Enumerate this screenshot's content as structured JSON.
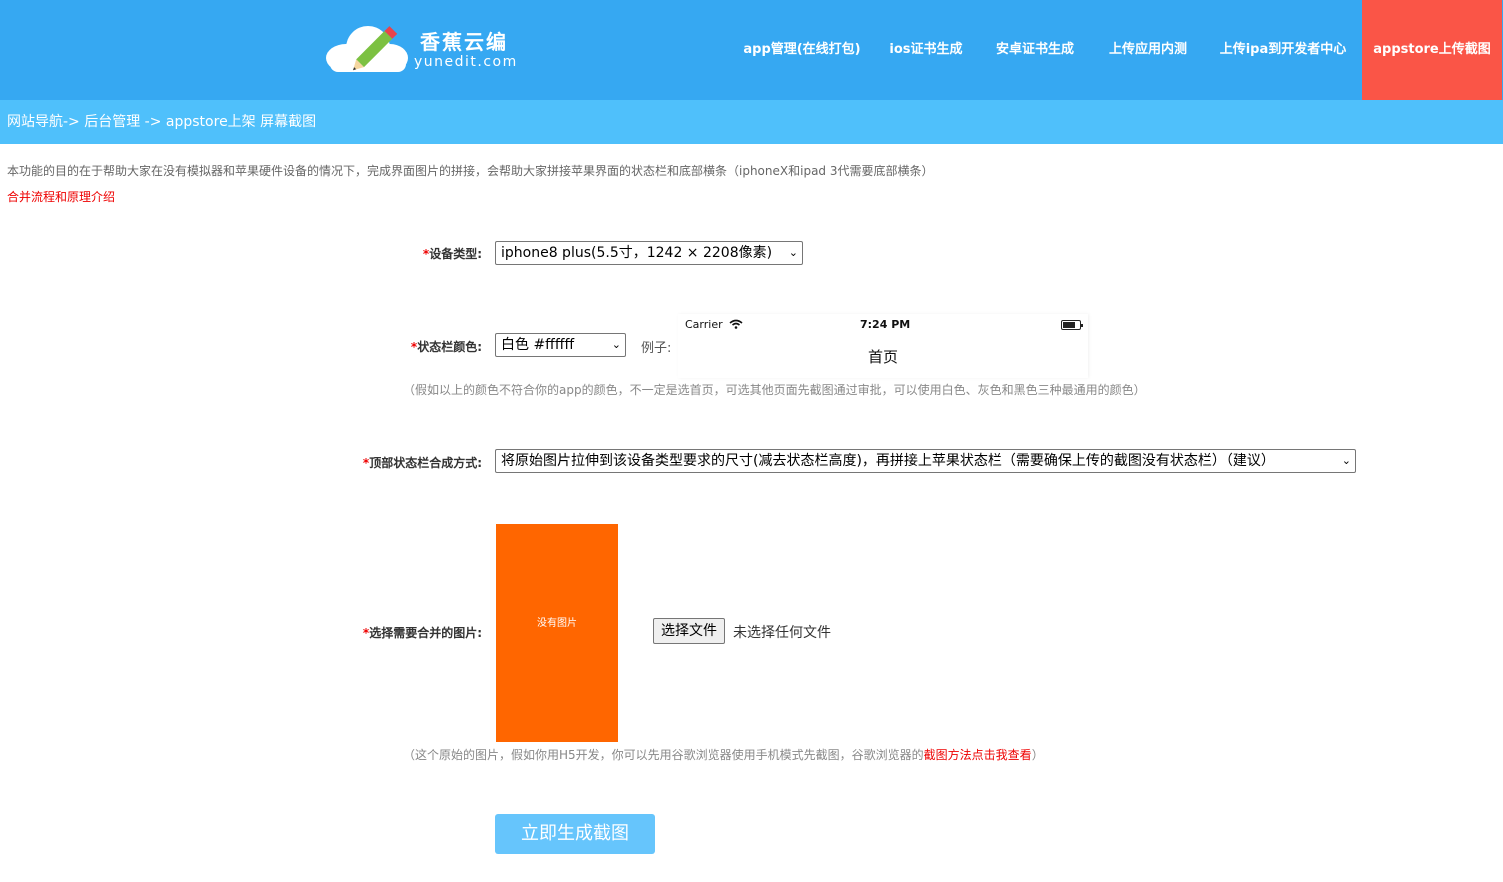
{
  "header": {
    "logo_title": "香蕉云编",
    "logo_sub": "yunedit.com",
    "nav": [
      {
        "label": "app管理(在线打包)"
      },
      {
        "label": "ios证书生成"
      },
      {
        "label": "安卓证书生成"
      },
      {
        "label": "上传应用内测"
      },
      {
        "label": "上传ipa到开发者中心"
      },
      {
        "label": "appstore上传截图"
      }
    ],
    "colors": {
      "bar": "#36a8f2",
      "active": "#fa5547"
    }
  },
  "breadcrumb": "网站导航-> 后台管理 -> appstore上架 屏幕截图",
  "intro": {
    "text": "本功能的目的在于帮助大家在没有模拟器和苹果硬件设备的情况下，完成界面图片的拼接，会帮助大家拼接苹果界面的状态栏和底部横条（iphoneX和ipad 3代需要底部横条）",
    "link": "合并流程和原理介绍"
  },
  "form": {
    "required_mark": "*",
    "device_label": "设备类型:",
    "device_value": "iphone8 plus(5.5寸，1242 × 2208像素)",
    "statusbar_label": "状态栏颜色:",
    "statusbar_value": "白色 #ffffff",
    "example_label": "例子:",
    "example": {
      "carrier": "Carrier",
      "time": "7:24 PM",
      "title": "首页"
    },
    "statusbar_hint": "（假如以上的颜色不符合你的app的颜色，不一定是选首页，可选其他页面先截图通过审批，可以使用白色、灰色和黑色三种最通用的颜色）",
    "compose_label": "顶部状态栏合成方式:",
    "compose_value": "将原始图片拉伸到该设备类型要求的尺寸(减去状态栏高度)，再拼接上苹果状态栏（需要确保上传的截图没有状态栏）（建议）",
    "image_label": "选择需要合并的图片:",
    "placeholder_text": "没有图片",
    "file_button": "选择文件",
    "file_status": "未选择任何文件",
    "image_hint_prefix": "（这个原始的图片，假如你用H5开发，你可以先用谷歌浏览器使用手机模式先截图，谷歌浏览器的",
    "image_hint_link": "截图方法点击我查看",
    "image_hint_suffix": "）",
    "submit": "立即生成截图"
  }
}
